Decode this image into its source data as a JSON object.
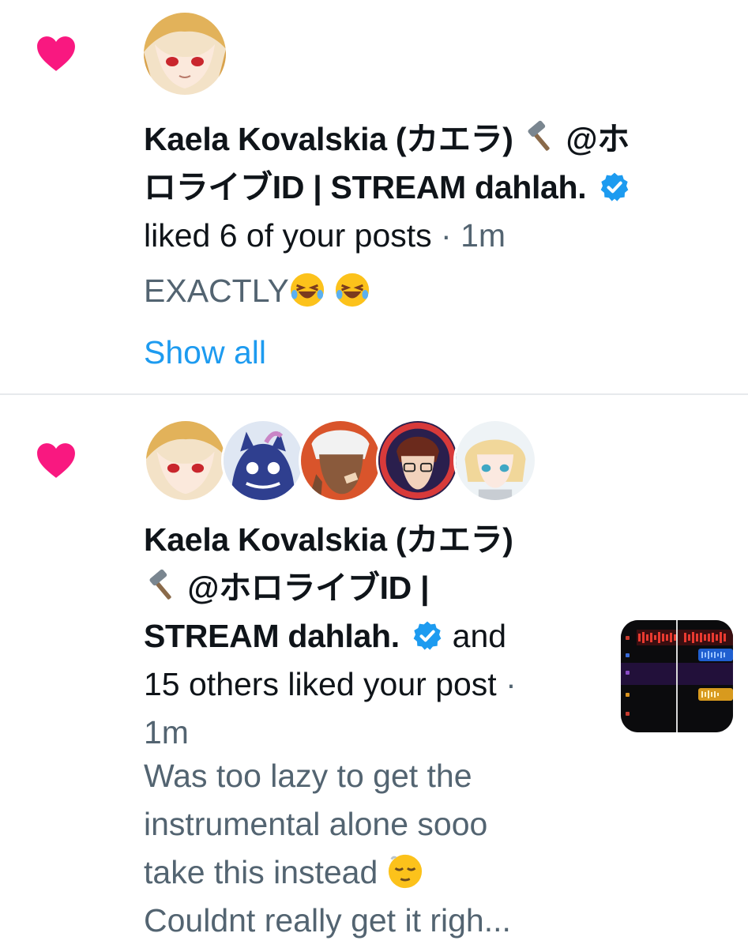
{
  "colors": {
    "heart": "#f91880",
    "verified": "#1d9bf0",
    "link": "#1d9bf0",
    "secondary_text": "#536471",
    "primary_text": "#0f1419",
    "divider": "#e7e9ec"
  },
  "notifications": [
    {
      "type": "like",
      "icon": "heart-icon",
      "user_name": "Kaela Kovalskia (カエラ) 🔨 @ホロライブID | STREAM dahlah.",
      "name_line1": "Kaela Kovalskia (カエラ)",
      "name_line1_tail": "@ホ",
      "name_line2": "ロライブID | STREAM dahlah.",
      "action_text": "liked 6 of your posts",
      "separator": "·",
      "time": "1m",
      "preview_text": "EXACTLY",
      "show_all_label": "Show all"
    },
    {
      "type": "like",
      "icon": "heart-icon",
      "avatars": [
        "avatar-kaela",
        "avatar-monster",
        "avatar-white-hair",
        "avatar-glasses",
        "avatar-blonde"
      ],
      "name_line1": "Kaela Kovalskia (カエラ)",
      "name_line2": "@ホロライブID |",
      "name_line3": "STREAM dahlah.",
      "action_and": "and",
      "action_text": "15 others liked your post",
      "separator": "·",
      "time": "1m",
      "preview_line1": "Was too lazy to get the",
      "preview_line2": "instrumental alone sooo",
      "preview_line3": "take this instead",
      "preview_line4": "Couldnt really get it righ..."
    }
  ]
}
